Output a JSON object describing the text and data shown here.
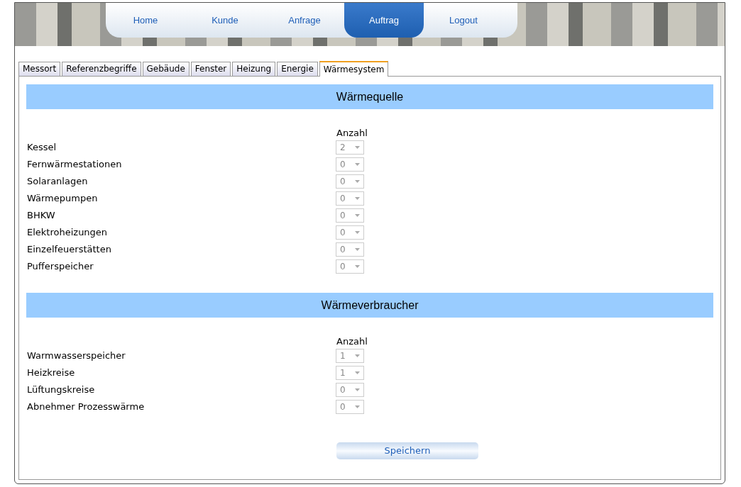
{
  "nav": [
    {
      "label": "Home",
      "selected": false
    },
    {
      "label": "Kunde",
      "selected": false
    },
    {
      "label": "Anfrage",
      "selected": false
    },
    {
      "label": "Auftrag",
      "selected": true
    },
    {
      "label": "Logout",
      "selected": false
    }
  ],
  "tabs": [
    {
      "label": "Messort",
      "selected": false
    },
    {
      "label": "Referenzbegriffe",
      "selected": false
    },
    {
      "label": "Gebäude",
      "selected": false
    },
    {
      "label": "Fenster",
      "selected": false
    },
    {
      "label": "Heizung",
      "selected": false
    },
    {
      "label": "Energie",
      "selected": false
    },
    {
      "label": "Wärmesystem",
      "selected": true
    }
  ],
  "sections": [
    {
      "title": "Wärmequelle",
      "column_heading": "Anzahl",
      "rows": [
        {
          "label": "Kessel",
          "value": "2",
          "disabled": true
        },
        {
          "label": "Fernwärmestationen",
          "value": "0",
          "disabled": true
        },
        {
          "label": "Solaranlagen",
          "value": "0",
          "disabled": true
        },
        {
          "label": "Wärmepumpen",
          "value": "0",
          "disabled": true
        },
        {
          "label": "BHKW",
          "value": "0",
          "disabled": true
        },
        {
          "label": "Elektroheizungen",
          "value": "0",
          "disabled": true
        },
        {
          "label": "Einzelfeuerstätten",
          "value": "0",
          "disabled": true
        },
        {
          "label": "Pufferspeicher",
          "value": "0",
          "disabled": true
        }
      ]
    },
    {
      "title": "Wärmeverbraucher",
      "column_heading": "Anzahl",
      "rows": [
        {
          "label": "Warmwasserspeicher",
          "value": "1",
          "disabled": true
        },
        {
          "label": "Heizkreise",
          "value": "1",
          "disabled": true
        },
        {
          "label": "Lüftungskreise",
          "value": "0",
          "disabled": true
        },
        {
          "label": "Abnehmer Prozesswärme",
          "value": "0",
          "disabled": true
        }
      ]
    }
  ],
  "save_button": "Speichern"
}
